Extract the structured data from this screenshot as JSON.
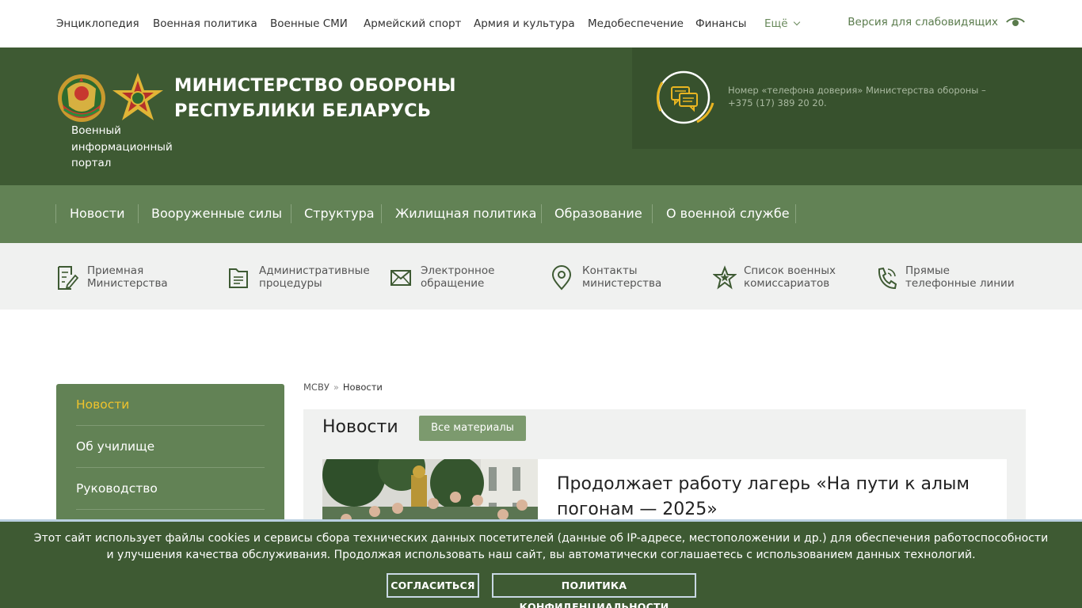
{
  "topnav": {
    "items": [
      "Энциклопедия",
      "Военная политика",
      "Военные СМИ",
      "Армейский спорт",
      "Армия и культура",
      "Медобеспечение",
      "Финансы"
    ],
    "more_label": "Ещё",
    "vision_label": "Версия для слабовидящих"
  },
  "header": {
    "ministry_line1": "МИНИСТЕРСТВО ОБОРОНЫ",
    "ministry_line2": "РЕСПУБЛИКИ БЕЛАРУСЬ",
    "portal_label": "Военный информационный портал",
    "hotline_text": "Номер «телефона доверия» Министерства обороны – +375 (17) 389 20 20."
  },
  "mainnav": {
    "items": [
      "Новости",
      "Вооруженные силы",
      "Структура",
      "Жилищная политика",
      "Образование",
      "О военной службе"
    ]
  },
  "quicklinks": [
    {
      "label": "Приемная\nМинистерства",
      "icon": "document-edit-icon"
    },
    {
      "label": "Административные\nпроцедуры",
      "icon": "folder-document-icon"
    },
    {
      "label": "Электронное\nобращение",
      "icon": "envelope-icon"
    },
    {
      "label": "Контакты\nминистерства",
      "icon": "location-pin-icon"
    },
    {
      "label": "Список военных\nкомиссариатов",
      "icon": "star-icon"
    },
    {
      "label": "Прямые\nтелефонные линии",
      "icon": "phone-icon"
    }
  ],
  "sidebar": {
    "items": [
      "Новости",
      "Об училище",
      "Руководство"
    ]
  },
  "breadcrumb": {
    "home": "МСВУ",
    "separator": "»",
    "current": "Новости"
  },
  "content": {
    "title": "Новости",
    "all_button": "Все материалы",
    "news_title": "Продолжает работу лагерь «На пути к алым погонам — 2025»"
  },
  "cookie": {
    "text": "Этот сайт использует файлы cookies и сервисы сбора технических данных посетителей (данные об IP-адресе, местоположении и др.) для обеспечения работоспособности и улучшения качества обслуживания. Продолжая использовать наш сайт, вы автоматически соглашаетесь с использованием данных технологий.",
    "agree_button": "СОГЛАСИТЬСЯ",
    "privacy_button": "ПОЛИТИКА КОНФИДЕНЦИАЛЬНОСТИ"
  },
  "colors": {
    "header_green": "#3e5a33",
    "nav_green": "#628255",
    "accent_gold": "#f0c32c",
    "button_green": "#7c9a6e"
  }
}
